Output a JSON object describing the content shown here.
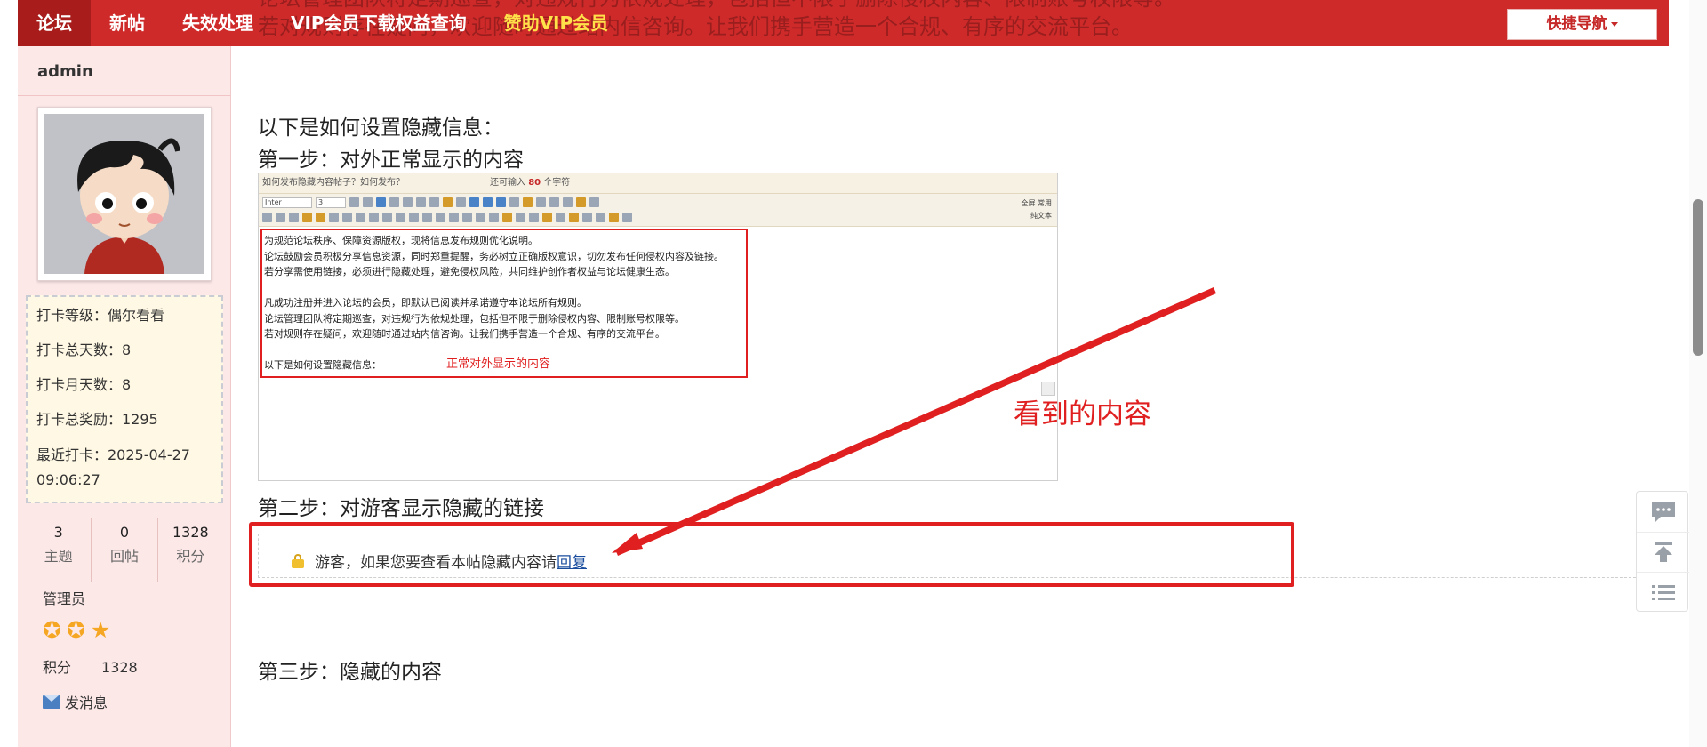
{
  "header": {
    "bleed_lines": [
      "论坛管理团队将定期巡查，对违规行为依规处理，包括但不限于删除侵权内容、限制账号权限等。",
      "若对规则存在疑问，欢迎随时通过站内信咨询。让我们携手营造一个合规、有序的交流平台。"
    ],
    "nav": [
      "论坛",
      "新帖",
      "失效处理",
      "VIP会员下载权益查询",
      "赞助VIP会员"
    ],
    "quick_nav": "快捷导航"
  },
  "sidebar": {
    "username": "admin",
    "checkin": {
      "level": "打卡等级：偶尔看看",
      "total_days": "打卡总天数：8",
      "month_days": "打卡月天数：8",
      "reward": "打卡总奖励：1295",
      "last": "最近打卡：2025-04-27 09:06:27"
    },
    "stats": [
      {
        "value": "3",
        "label": "主题"
      },
      {
        "value": "0",
        "label": "回帖"
      },
      {
        "value": "1328",
        "label": "积分"
      }
    ],
    "role": "管理员",
    "score_label": "积分",
    "score_value": "1328",
    "message": "发消息"
  },
  "post": {
    "intro": "以下是如何设置隐藏信息：",
    "step1": "第一步：对外正常显示的内容",
    "step2": "第二步：对游客显示隐藏的链接",
    "step3": "第三步：隐藏的内容",
    "hidden_text": "游客，如果您要查看本帖隐藏内容请",
    "reply": "回复",
    "annotation": "看到的内容"
  },
  "editor_shot": {
    "title_placeholder": "如何发布隐藏内容帖子？如何发布？",
    "count_prefix": "还可输入",
    "count_value": "80",
    "count_suffix": "个字符",
    "font": "Inter",
    "size": "3",
    "toolbar_right_1": "全屏 常用",
    "toolbar_right_2": "纯文本",
    "lines": [
      "为规范论坛秩序、保障资源版权，现将信息发布规则优化说明。",
      "论坛鼓励会员积极分享信息资源，同时郑重提醒，务必树立正确版权意识，切勿发布任何侵权内容及链接。",
      "若分享需使用链接，必须进行隐藏处理，避免侵权风险，共同维护创作者权益与论坛健康生态。",
      "凡成功注册并进入论坛的会员，即默认已阅读并承诺遵守本论坛所有规则。",
      "论坛管理团队将定期巡查，对违规行为依规处理，包括但不限于删除侵权内容、限制账号权限等。",
      "若对规则存在疑问，欢迎随时通过站内信咨询。让我们携手营造一个合规、有序的交流平台。",
      "以下是如何设置隐藏信息："
    ],
    "note": "正常对外显示的内容"
  },
  "icons": {
    "lock": "lock-icon",
    "mail": "mail-icon",
    "chat": "chat-icon",
    "top": "back-to-top-icon",
    "list": "list-icon"
  },
  "colors": {
    "header_red": "#cf2a2a",
    "vip_yellow": "#ffe24a",
    "annotation_red": "#e02020",
    "sidebar_pink": "#fde8e8"
  }
}
